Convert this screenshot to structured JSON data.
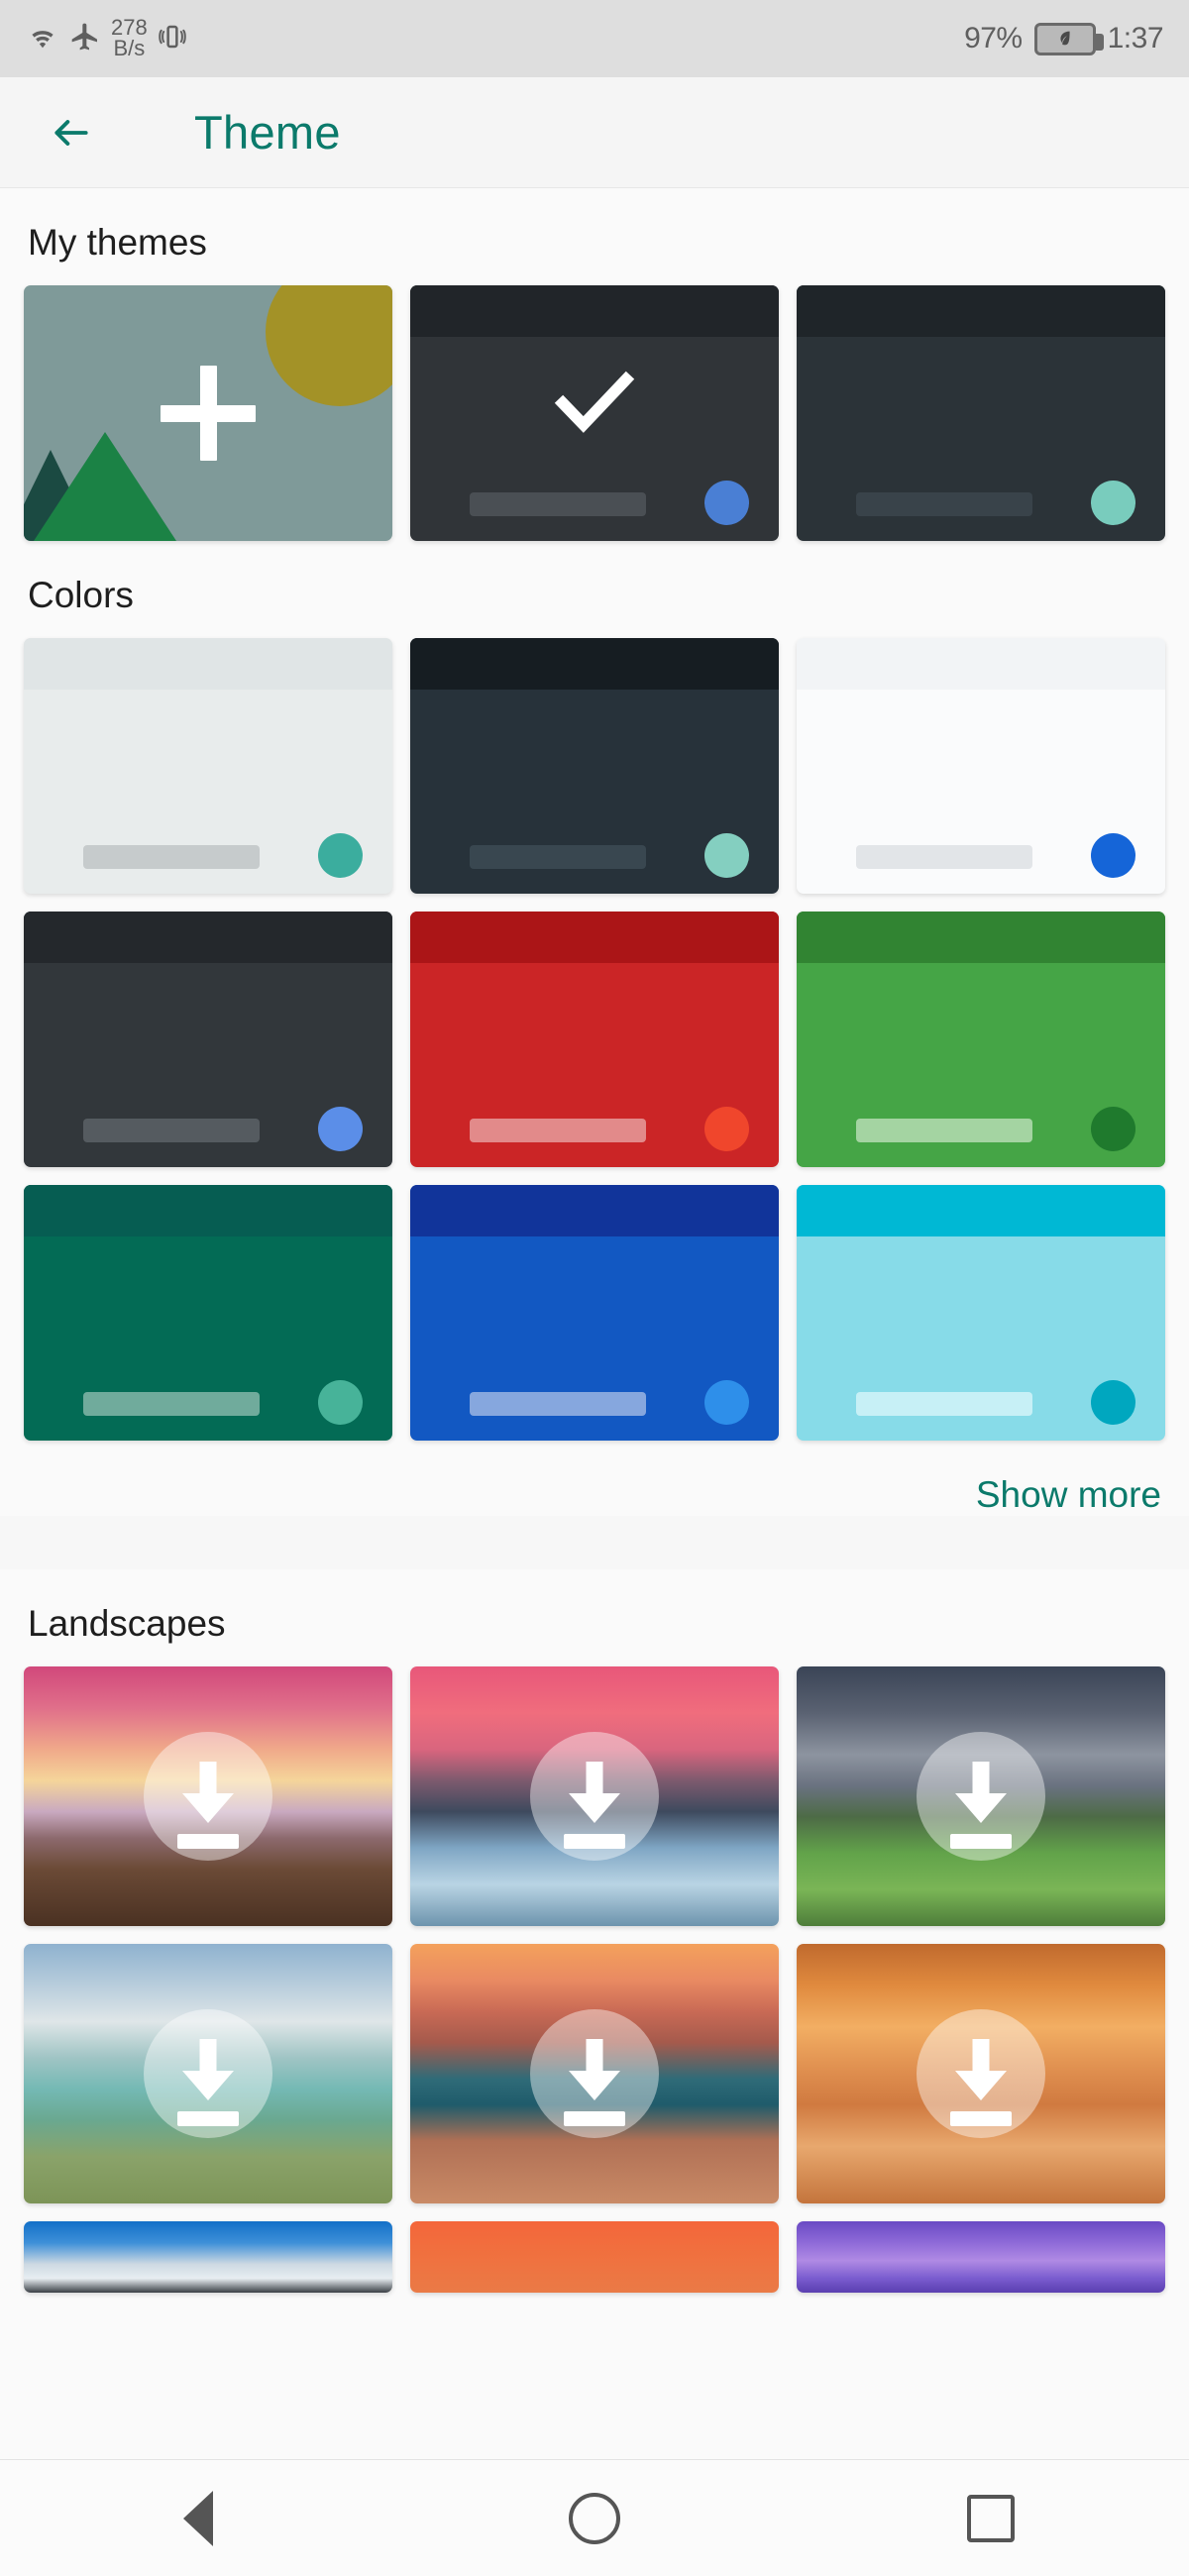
{
  "status_bar": {
    "wifi_icon": "wifi-icon",
    "airplane_icon": "airplane-mode-icon",
    "network_speed_value": "278",
    "network_speed_unit": "B/s",
    "vibrate_icon": "vibrate-icon",
    "battery_percent": "97%",
    "battery_icon": "battery-saver-leaf-icon",
    "clock": "1:37",
    "background": "#dedede"
  },
  "app_bar": {
    "back_icon": "back-arrow-icon",
    "title": "Theme",
    "accent": "#0b7a6b",
    "background": "#f5f5f5"
  },
  "my_themes": {
    "title": "My themes",
    "cards": [
      {
        "name": "create-custom-theme",
        "type": "create",
        "background": "#7f9a99",
        "sun_color": "#a39227",
        "mountain_front": "#1b8245",
        "mountain_back": "#1b4a42",
        "icon": "plus-icon",
        "selected": false
      },
      {
        "name": "dark-theme-blue",
        "type": "preview",
        "background": "#303438",
        "topbar": "#212529",
        "pill": "#4a4f54",
        "dot": "#4a7fd4",
        "icon": "check-icon",
        "selected": true
      },
      {
        "name": "dark-theme-teal",
        "type": "preview",
        "background": "#2b3338",
        "topbar": "#1f2529",
        "pill": "#39434a",
        "dot": "#79ccbd",
        "selected": false
      }
    ]
  },
  "colors": {
    "title": "Colors",
    "show_more_label": "Show more",
    "show_more_color": "#0b7a6b",
    "cards": [
      {
        "name": "color-theme-light-gray",
        "background": "#e8ecec",
        "topbar": "#e0e5e6",
        "pill": "#c6cbcc",
        "dot": "#3bad9e"
      },
      {
        "name": "color-theme-dark-slate",
        "background": "#27323a",
        "topbar": "#161d22",
        "pill": "#394750",
        "dot": "#84cfc0"
      },
      {
        "name": "color-theme-white",
        "background": "#fafbfc",
        "topbar": "#f2f4f6",
        "pill": "#e2e5e8",
        "dot": "#1565d8"
      },
      {
        "name": "color-theme-charcoal",
        "background": "#32373b",
        "topbar": "#24282c",
        "pill": "#555b60",
        "dot": "#5b8ee8"
      },
      {
        "name": "color-theme-red",
        "background": "#cb2526",
        "topbar": "#ab1517",
        "pill": "#e28a8a",
        "dot": "#f0462c"
      },
      {
        "name": "color-theme-green",
        "background": "#45a546",
        "topbar": "#318432",
        "pill": "#a4d4a2",
        "dot": "#1f7a2d"
      },
      {
        "name": "color-theme-teal-dark",
        "background": "#036b55",
        "topbar": "#065d52",
        "pill": "#70ab9c",
        "dot": "#47b399"
      },
      {
        "name": "color-theme-blue",
        "background": "#1258c2",
        "topbar": "#11349a",
        "pill": "#86a7de",
        "dot": "#2e8fea"
      },
      {
        "name": "color-theme-cyan-light",
        "background": "#87dbe8",
        "topbar": "#00b8d4",
        "pill": "#c7f0f6",
        "dot": "#00a7bf"
      }
    ]
  },
  "landscapes": {
    "title": "Landscapes",
    "download_icon": "download-icon",
    "cards": [
      {
        "name": "landscape-beach-sunset-rocks",
        "alt": "Beach sunset with boulders",
        "downloadable": true
      },
      {
        "name": "landscape-icy-river-pink-sky",
        "alt": "Frozen river at pink sunset",
        "downloadable": true
      },
      {
        "name": "landscape-green-hills-storm",
        "alt": "Green hills under storm clouds",
        "downloadable": true
      },
      {
        "name": "landscape-lagoon-cloudy-beach",
        "alt": "Lagoon beach under clouds",
        "downloadable": true
      },
      {
        "name": "landscape-horseshoe-bend",
        "alt": "Canyon river bend at sunset",
        "downloadable": true
      },
      {
        "name": "landscape-antelope-canyon",
        "alt": "Orange slot canyon",
        "downloadable": true
      },
      {
        "name": "landscape-blue-sky-mountain",
        "alt": "Blue sky with clouds",
        "downloadable": true
      },
      {
        "name": "landscape-orange-gradient",
        "alt": "Orange gradient",
        "downloadable": true
      },
      {
        "name": "landscape-purple-flowers",
        "alt": "Purple flowers",
        "downloadable": true
      }
    ]
  },
  "nav_bar": {
    "back_icon": "nav-back-triangle-icon",
    "home_icon": "nav-home-circle-icon",
    "recents_icon": "nav-recents-square-icon"
  }
}
